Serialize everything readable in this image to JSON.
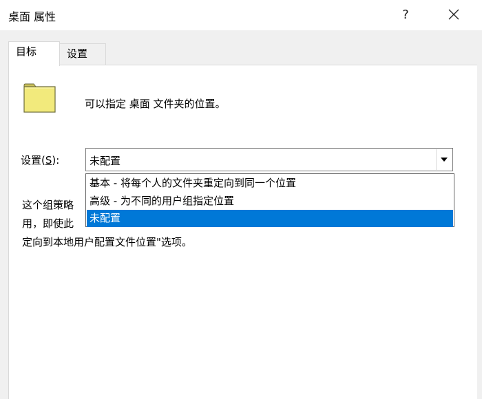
{
  "window": {
    "title": "桌面 属性",
    "help_label": "?"
  },
  "tabs": [
    {
      "label": "目标",
      "active": true
    },
    {
      "label": "设置",
      "active": false
    }
  ],
  "target": {
    "description": "可以指定 桌面 文件夹的位置。",
    "setting_label_prefix": "设置(",
    "setting_label_accel": "S",
    "setting_label_suffix": "):",
    "selected_value": "未配置",
    "options": [
      "基本 - 将每个人的文件夹重定向到同一个位置",
      "高级 - 为不同的用户组指定位置",
      "未配置"
    ],
    "info_lines": [
      "这个组策略",
      "用，即使此",
      "定向到本地用户配置文件位置\"选项。"
    ]
  },
  "colors": {
    "selection": "#0078d7",
    "folder": "#f2ea7c"
  }
}
